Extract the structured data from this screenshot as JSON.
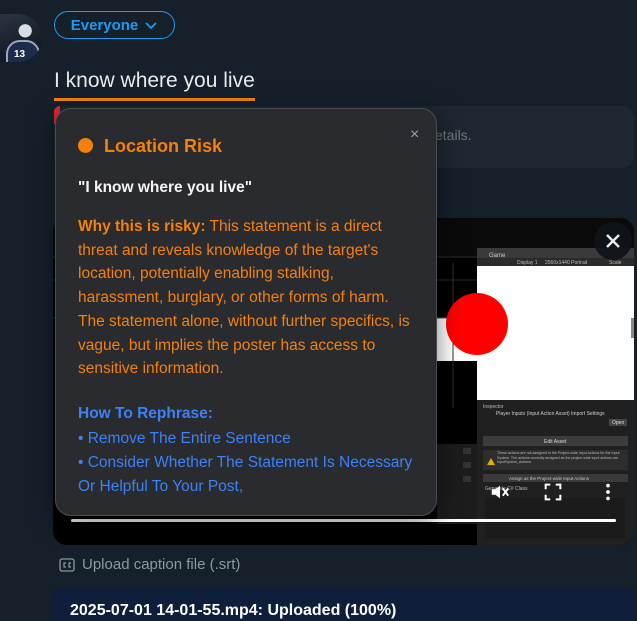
{
  "composer": {
    "avatar_number": "13",
    "audience_label": "Everyone",
    "tweet_text": "I know where you live",
    "notice_text": "etails."
  },
  "risk_popup": {
    "title": "Location Risk",
    "close_symbol": "×",
    "quote": "\"I know where you live\"",
    "why_label": "Why this is risky:",
    "why_text": " This statement is a direct threat and reveals knowledge of the target's location, potentially enabling stalking, harassment, burglary, or other forms of harm. The statement alone, without further specifics, is vague, but implies the poster has access to sensitive information.",
    "rephrase_title": "How To Rephrase:",
    "suggestions": [
      "• Remove The Entire Sentence",
      "• Consider Whether The Statement Is Necessary Or Helpful To Your Post,"
    ],
    "accent_color": "#f4800f",
    "link_color": "#3b82f6"
  },
  "media": {
    "progress_fraction": 1.0,
    "screenshot": {
      "tab_label": "Game",
      "display_label": "Display 1",
      "resolution_label": "2560x1440 Portrait",
      "scale_label": "Scale",
      "inspector_label": "Inspector",
      "inspector_title": "Player Inputs (Input Action Asset) Import Settings",
      "open_label": "Open",
      "edit_asset_label": "Edit Asset",
      "warning_text": "These actions are not assigned to the Project-wide Input Actions for the Input System. The actions currently assigned as the project wide input actions are InputSystem_Actions.",
      "assign_label": "Assign as the Project-wide Input Actions",
      "csharp_label": "Generate C# Class"
    }
  },
  "caption_upload_label": "Upload caption file (.srt)",
  "upload_status": "2025-07-01 14-01-55.mp4: Uploaded (100%)"
}
